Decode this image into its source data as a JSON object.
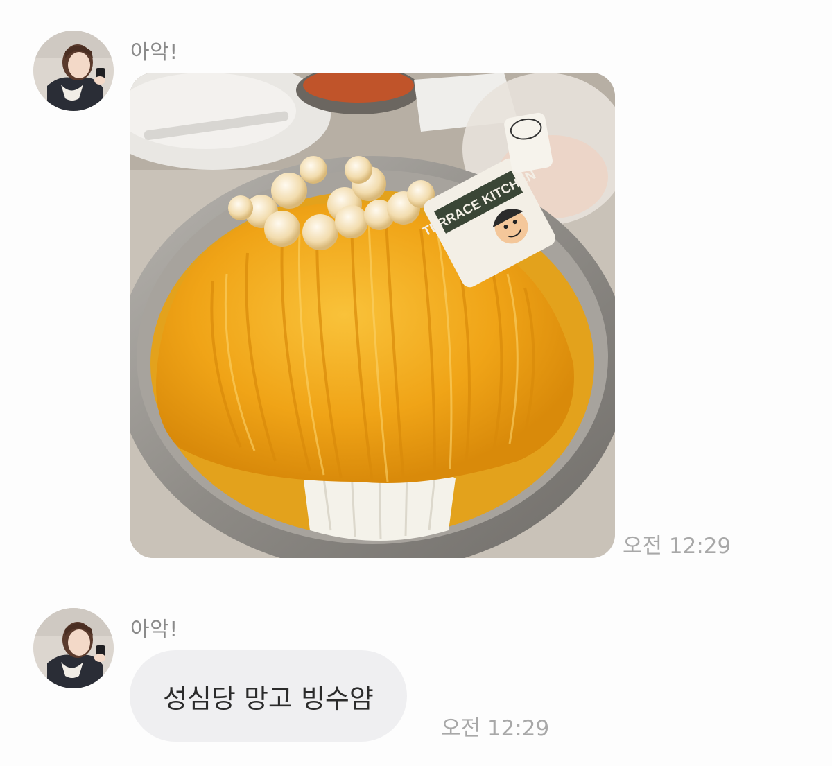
{
  "messages": [
    {
      "sender": "아악!",
      "type": "image",
      "image_description_icon": "mango-bingsu-photo",
      "photo_sign_text": "TERRACE KITCHEN",
      "time": "오전 12:29"
    },
    {
      "sender": "아악!",
      "type": "text",
      "text": "성심당 망고 빙수얌",
      "time": "오전 12:29"
    }
  ],
  "colors": {
    "background": "#fdfdfd",
    "bubble": "#efeff1",
    "sender_text": "#8a8a8a",
    "time_text": "#a8a8a8",
    "message_text": "#2b2b2b",
    "mango": "#f2a71b"
  }
}
